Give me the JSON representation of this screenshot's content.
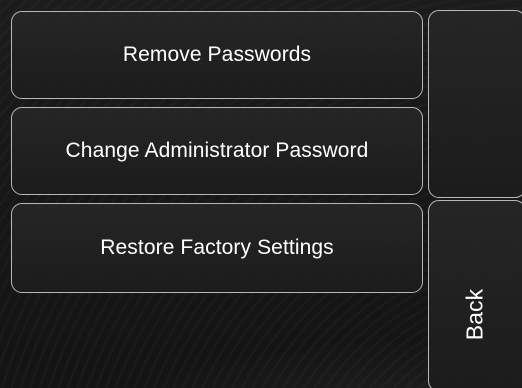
{
  "menu": {
    "remove_passwords_label": "Remove Passwords",
    "change_admin_password_label": "Change Administrator Password",
    "restore_factory_settings_label": "Restore Factory Settings"
  },
  "side": {
    "back_label": "Back"
  },
  "colors": {
    "background": "#141414",
    "button_border": "#b8b8b8",
    "text": "#ffffff"
  }
}
